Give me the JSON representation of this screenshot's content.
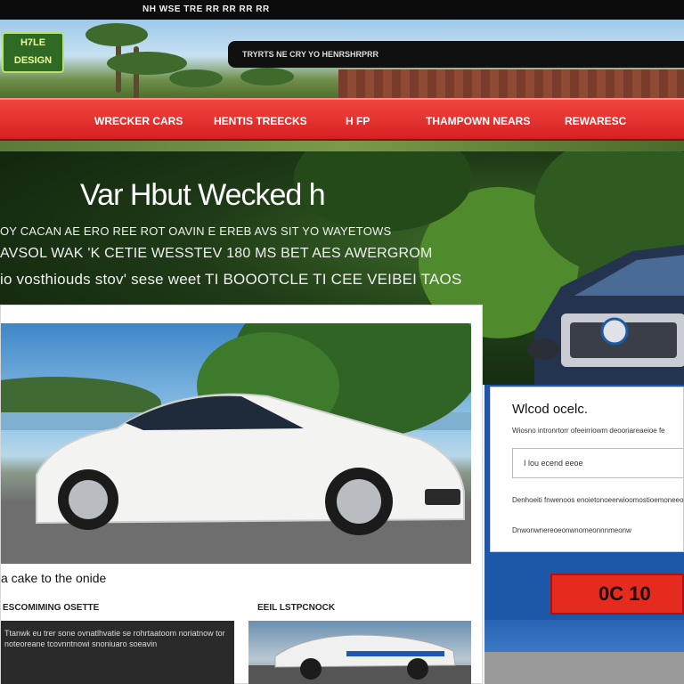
{
  "topbar": {
    "text": "NH  WSE  TRE RR RR RR RR"
  },
  "header": {
    "logo_text": "H7LE DESIGN",
    "search_placeholder": "TRYRTS   NE CRY YO   HENRSHRPRR"
  },
  "nav": {
    "items": [
      {
        "label": "Wrecker Cars"
      },
      {
        "label": "Hentis Treecks"
      },
      {
        "label": "H FP"
      },
      {
        "label": "Thampown Nears"
      },
      {
        "label": "Rewaresc"
      }
    ]
  },
  "hero": {
    "title": "Var Hbut Wecked h",
    "line1": "OY CACAN AE ERO REE ROT OAVIN E EREB AVS SIT YO WAYETOWS",
    "line2": "AVSOL WAK 'K  CETIE WESSTEV 180 MS BET AES AWERGROM",
    "line3": "io vosthiouds stov' sese weet TI BOOOTCLE TI CEE VEIBEI TAOS"
  },
  "main": {
    "caption": "a cake to the onide",
    "sub_left": "ESCOMIMING OSETTE",
    "sub_right": "EEIL LSTPCNOCK",
    "tile_left_text": "Ttanwk eu trer sone ovnatlhvatie se rohrtaatoom noriatnow tor noteoreane tcovnntnowi snoniuaro soeavin"
  },
  "sidebar": {
    "form_title": "Wlcod ocelc.",
    "line1": "Wiosno intronrtorr ofeeirriowm deooriareaeioe fe",
    "input_value": "I  lou ecend eeoe",
    "line2": "Denhoeiti fnwenoos enoietonoeerwioomostioemoneeo",
    "line3": "Dnwonwnereoeonwnomeonnnmeonw",
    "cta_label": "0C  10"
  }
}
